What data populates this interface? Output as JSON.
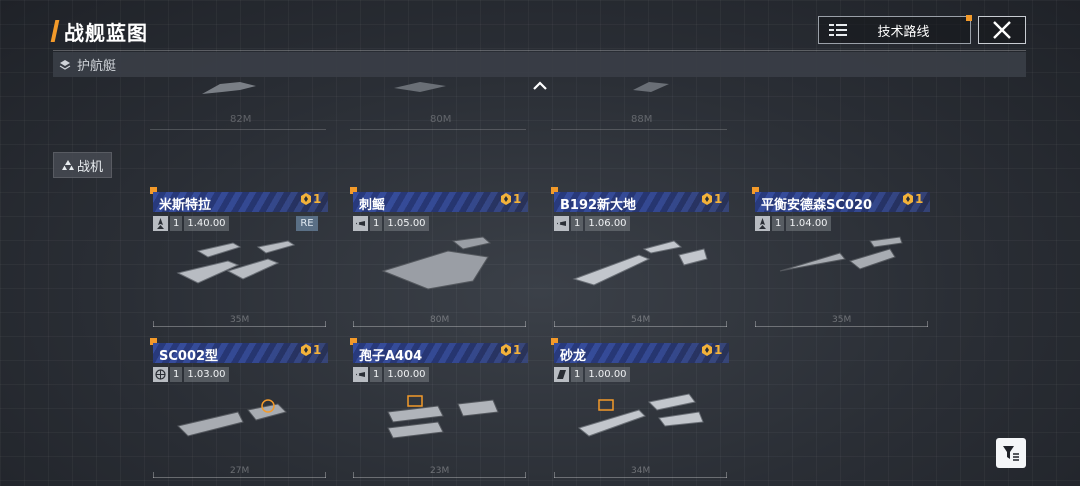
{
  "header": {
    "title": "战舰蓝图",
    "tech_route_label": "技术路线",
    "accent": "#f39a2a"
  },
  "frigate_section": {
    "label": "护航艇",
    "remnant_lengths": [
      "82M",
      "80M",
      "88M"
    ]
  },
  "fighter_section": {
    "label": "战机",
    "cards": [
      {
        "name": "米斯特拉",
        "count": "1",
        "class_level": "1",
        "value": "1.40.00",
        "badge": "RE",
        "length": "35M",
        "icon": "rocket-icon"
      },
      {
        "name": "刺鳐",
        "count": "1",
        "class_level": "1",
        "value": "1.05.00",
        "badge": "",
        "length": "80M",
        "icon": "ship-class-icon"
      },
      {
        "name": "B192新大地",
        "count": "1",
        "class_level": "1",
        "value": "1.06.00",
        "badge": "",
        "length": "54M",
        "icon": "ship-class-icon"
      },
      {
        "name": "平衡安德森SC020",
        "count": "1",
        "class_level": "1",
        "value": "1.04.00",
        "badge": "",
        "length": "35M",
        "icon": "rocket-icon"
      },
      {
        "name": "SC002型",
        "count": "1",
        "class_level": "1",
        "value": "1.03.00",
        "badge": "",
        "length": "27M",
        "icon": "globe-icon"
      },
      {
        "name": "孢子A404",
        "count": "1",
        "class_level": "1",
        "value": "1.00.00",
        "badge": "",
        "length": "23M",
        "icon": "ship-class-icon"
      },
      {
        "name": "砂龙",
        "count": "1",
        "class_level": "1",
        "value": "1.00.00",
        "badge": "",
        "length": "34M",
        "icon": "flag-icon"
      }
    ]
  },
  "colors": {
    "name_band": "#2f4aa8",
    "count_gold": "#f3b23a",
    "re_badge": "#5a6f85"
  }
}
